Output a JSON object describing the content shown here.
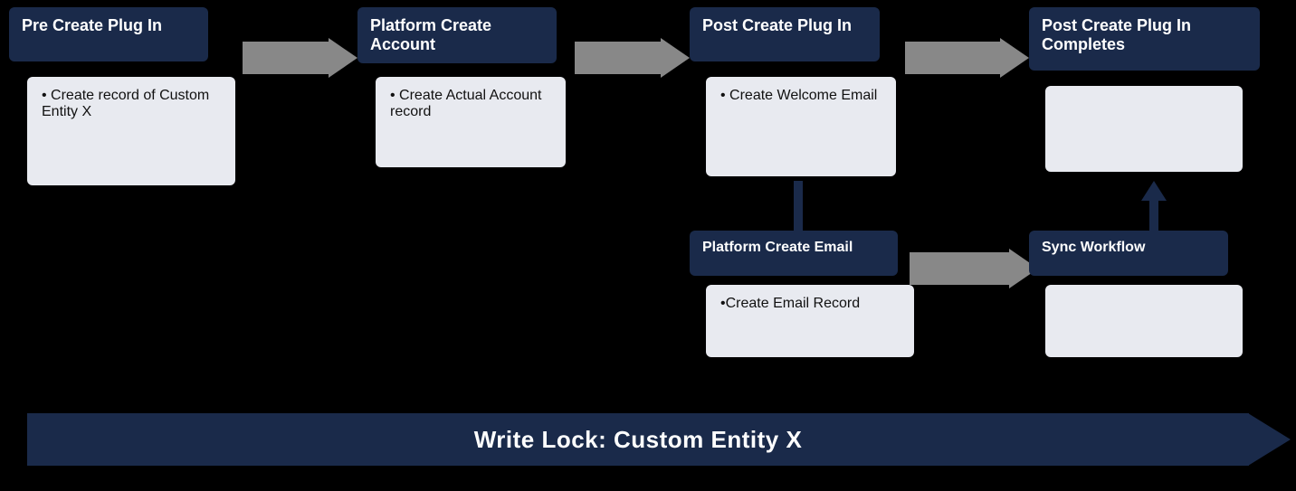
{
  "boxes": {
    "preCreate": {
      "label": "Pre Create Plug In",
      "action": "Create record of Custom Entity X"
    },
    "platformCreate": {
      "label": "Platform Create Account",
      "action": "Create Actual Account record"
    },
    "postCreate": {
      "label": "Post Create Plug In",
      "action": "Create Welcome Email"
    },
    "postCreateCompletes": {
      "label": "Post Create Plug In Completes",
      "action": ""
    },
    "platformEmail": {
      "label": "Platform Create Email",
      "action": "Create Email Record"
    },
    "syncWorkflow": {
      "label": "Sync Workflow",
      "action": ""
    }
  },
  "writeLock": {
    "text": "Write Lock: Custom Entity X"
  }
}
